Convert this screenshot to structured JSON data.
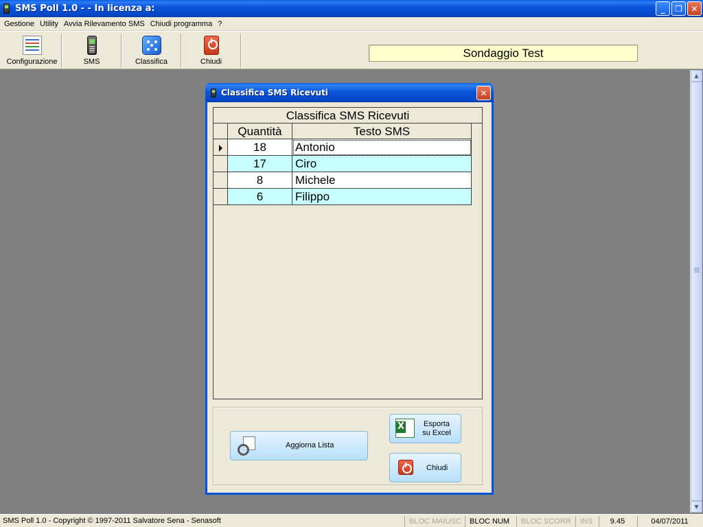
{
  "window": {
    "title": "SMS Poll 1.0 - - In licenza a:",
    "controls": [
      "minimize",
      "maximize",
      "close"
    ]
  },
  "menu": [
    "Gestione",
    "Utility",
    "Avvia Rilevamento SMS",
    "Chiudi programma",
    "?"
  ],
  "toolbar": {
    "buttons": [
      {
        "label": "Configurazione",
        "icon": "settings-list-icon"
      },
      {
        "label": "SMS",
        "icon": "mobile-phone-icon"
      },
      {
        "label": "Classifica",
        "icon": "dice-icon"
      },
      {
        "label": "Chiudi",
        "icon": "power-icon"
      }
    ],
    "poll_name": "Sondaggio Test"
  },
  "dialog": {
    "title": "Classifica SMS Ricevuti",
    "grid": {
      "caption": "Classifica SMS Ricevuti",
      "columns": [
        "Quantità",
        "Testo SMS"
      ],
      "rows": [
        {
          "qty": "18",
          "text": "Antonio"
        },
        {
          "qty": "17",
          "text": "Ciro"
        },
        {
          "qty": "8",
          "text": "Michele"
        },
        {
          "qty": "6",
          "text": "Filippo"
        }
      ]
    },
    "buttons": {
      "refresh": "Aggiorna Lista",
      "export": "Esporta\nsu Excel",
      "close": "Chiudi"
    },
    "row_alt_color": "#c6ffff"
  },
  "status": {
    "copyright": "SMS Poll 1.0 - Copyright © 1997-2011 Salvatore Sena - Senasoft",
    "caps": "BLOC MAIUSC",
    "num": "BLOC NUM",
    "scroll": "BLOC SCORR",
    "ins": "INS",
    "time": "9.45",
    "date": "04/07/2011"
  },
  "colors": {
    "titlebar": "#0553d8",
    "poll_field_bg": "#ffffcc"
  }
}
